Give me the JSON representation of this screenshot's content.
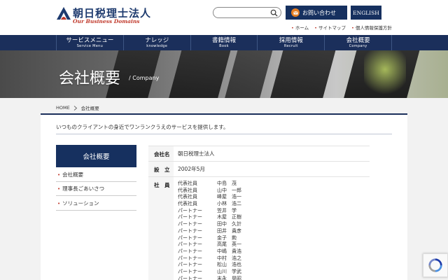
{
  "header": {
    "logo_name": "朝日税理士法人",
    "logo_sub": "Our Business Domains",
    "search_placeholder": "",
    "contact_label": "お問い合わせ",
    "english_label": "ENGLISH",
    "util_links": [
      "ホーム",
      "サイトマップ",
      "個人情報保護方針"
    ]
  },
  "nav": [
    {
      "jp": "サービスメニュー",
      "en": "Service Menu"
    },
    {
      "jp": "ナレッジ",
      "en": "knowledge"
    },
    {
      "jp": "書籍情報",
      "en": "Book"
    },
    {
      "jp": "採用情報",
      "en": "Recruit"
    },
    {
      "jp": "会社概要",
      "en": "Company"
    }
  ],
  "hero": {
    "title": "会社概要",
    "subtitle": "/ Company"
  },
  "breadcrumb": {
    "home": "HOME",
    "current": "会社概要"
  },
  "intro": "いつものクライアントの身近でワンランクうえのサービスを提供します。",
  "side_menu": {
    "title": "会社概要",
    "items": [
      "会社概要",
      "理事長ごあいさつ",
      "ソリューション"
    ]
  },
  "company_table": {
    "name_label": "会社名",
    "name_value": "朝日税理士法人",
    "founded_label": "設　立",
    "founded_value": "2002年5月",
    "staff_label": "社　員",
    "staff": [
      {
        "role": "代表社員",
        "name": "中島　茂"
      },
      {
        "role": "代表社員",
        "name": "山中　一郎"
      },
      {
        "role": "代表社員",
        "name": "峰屋　浩一"
      },
      {
        "role": "代表社員",
        "name": "小林　浩二"
      },
      {
        "role": "パートナー",
        "name": "笠井　学"
      },
      {
        "role": "パートナー",
        "name": "木屋　正樹"
      },
      {
        "role": "パートナー",
        "name": "田中　久計"
      },
      {
        "role": "パートナー",
        "name": "田井　貴彦"
      },
      {
        "role": "パートナー",
        "name": "金子　勲"
      },
      {
        "role": "パートナー",
        "name": "高尾　英一"
      },
      {
        "role": "パートナー",
        "name": "中嶋　貴浩"
      },
      {
        "role": "パートナー",
        "name": "中村　浩之"
      },
      {
        "role": "パートナー",
        "name": "松山　浩也"
      },
      {
        "role": "パートナー",
        "name": "山川　学武"
      },
      {
        "role": "パートナー",
        "name": "末永　晃昭"
      }
    ]
  },
  "colors": {
    "navy": "#1b2f5b",
    "accent_red": "#c0392b",
    "mail_orange": "#e67e22"
  }
}
